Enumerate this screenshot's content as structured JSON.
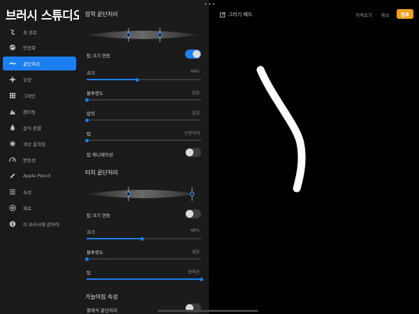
{
  "app": {
    "title": "브러시 스튜디오"
  },
  "sidebar": {
    "items": [
      {
        "label": "획 경로",
        "icon": "stroke-path-icon",
        "active": false
      },
      {
        "label": "안정화",
        "icon": "stabilization-icon",
        "active": false
      },
      {
        "label": "끝단처리",
        "icon": "taper-icon",
        "active": true
      },
      {
        "label": "모양",
        "icon": "shape-icon",
        "active": false
      },
      {
        "label": "그레인",
        "icon": "grain-icon",
        "active": false
      },
      {
        "label": "렌더링",
        "icon": "rendering-icon",
        "active": false
      },
      {
        "label": "습식 혼합",
        "icon": "wet-mix-icon",
        "active": false
      },
      {
        "label": "색상 움직임",
        "icon": "color-dynamics-icon",
        "active": false
      },
      {
        "label": "변동성",
        "icon": "dynamics-icon",
        "active": false
      },
      {
        "label": "Apple Pencil",
        "icon": "pencil-icon",
        "active": false
      },
      {
        "label": "속성",
        "icon": "properties-icon",
        "active": false
      },
      {
        "label": "재료",
        "icon": "materials-icon",
        "active": false
      },
      {
        "label": "이 브러시에 관하여",
        "icon": "info-icon",
        "active": false
      }
    ]
  },
  "pressure_taper": {
    "title": "압력 끝단처리",
    "tip_size_link": {
      "label": "팁 크기 연동",
      "on": true
    },
    "size": {
      "label": "크기",
      "value": "44%",
      "level": 0.44
    },
    "opacity": {
      "label": "불투명도",
      "value": "없음",
      "level": 0
    },
    "pressure": {
      "label": "압력",
      "value": "없음",
      "level": 0
    },
    "tip": {
      "label": "팁",
      "value": "선명하게",
      "level": 0
    },
    "tip_animation": {
      "label": "팁 애니메이션",
      "on": false
    }
  },
  "touch_taper": {
    "title": "터치 끝단처리",
    "tip_size_link": {
      "label": "팁 크기 연동",
      "on": false
    },
    "size": {
      "label": "크기",
      "value": "48%",
      "level": 0.48
    },
    "opacity": {
      "label": "불투명도",
      "value": "없음",
      "level": 0
    },
    "tip": {
      "label": "팁",
      "value": "뭉툭한",
      "level": 1.0
    }
  },
  "taper_properties": {
    "title": "가늘어짐 속성",
    "classic_taper": {
      "label": "클래식 끝단처리",
      "on": false
    }
  },
  "canvas": {
    "title": "그리기 패드",
    "import_label": "가져오기",
    "cancel_label": "취소",
    "done_label": "완료"
  },
  "colors": {
    "accent": "#1d7ef0",
    "done": "#f0a020"
  }
}
